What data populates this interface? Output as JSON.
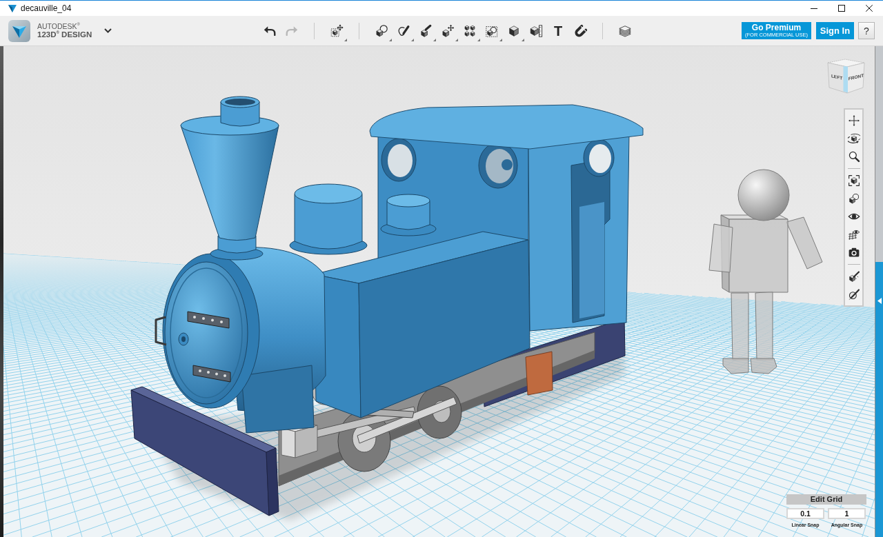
{
  "window": {
    "title": "decauville_04",
    "controls": [
      {
        "kind": "minimize"
      },
      {
        "kind": "maximize"
      },
      {
        "kind": "close"
      }
    ]
  },
  "app_menu": {
    "brand": "AUTODESK$^{®}$",
    "product": "123D$^{®}$ DESIGN"
  },
  "toolbar": {
    "groups": [
      {
        "tools": [
          {
            "kind": "undo",
            "disabled": false,
            "has_menu": false
          },
          {
            "kind": "redo",
            "disabled": true,
            "has_menu": false
          }
        ]
      },
      {
        "tools": [
          {
            "kind": "transform",
            "disabled": false,
            "has_menu": true
          }
        ]
      },
      {
        "tools": [
          {
            "kind": "primitives",
            "disabled": false,
            "has_menu": true
          },
          {
            "kind": "sketch",
            "disabled": false,
            "has_menu": true
          },
          {
            "kind": "construct",
            "disabled": false,
            "has_menu": true
          },
          {
            "kind": "modify",
            "disabled": false,
            "has_menu": true
          },
          {
            "kind": "pattern",
            "disabled": false,
            "has_menu": true
          },
          {
            "kind": "grouping",
            "disabled": false,
            "has_menu": true
          },
          {
            "kind": "combine",
            "disabled": false,
            "has_menu": true
          },
          {
            "kind": "measure",
            "disabled": false,
            "has_menu": false
          },
          {
            "kind": "text",
            "label": "T",
            "disabled": false,
            "has_menu": false
          },
          {
            "kind": "snap",
            "disabled": false,
            "has_menu": false
          }
        ]
      },
      {
        "tools": [
          {
            "kind": "material",
            "disabled": false,
            "has_menu": false
          }
        ]
      }
    ]
  },
  "account_buttons": [
    {
      "kind": "premium",
      "label": "Go Premium",
      "sublabel": "(FOR COMMERCIAL USE)"
    },
    {
      "kind": "sign_in",
      "label": "Sign In"
    },
    {
      "kind": "help",
      "label": "?"
    }
  ],
  "view_cube": {
    "faces": [
      {
        "label": "LEFT"
      },
      {
        "label": "FRONT"
      }
    ]
  },
  "navigation": {
    "groups": [
      {
        "tools": [
          {
            "kind": "pan"
          },
          {
            "kind": "orbit"
          },
          {
            "kind": "zoom"
          }
        ]
      },
      {
        "tools": [
          {
            "kind": "fit"
          },
          {
            "kind": "look_at"
          },
          {
            "kind": "visibility"
          },
          {
            "kind": "grid_visibility"
          },
          {
            "kind": "screenshot"
          }
        ]
      },
      {
        "tools": [
          {
            "kind": "material"
          },
          {
            "kind": "snap_material"
          }
        ]
      }
    ]
  },
  "edit_grid": {
    "title": "Edit Grid",
    "fields": [
      {
        "value": "0.1",
        "label": "Linear Snap"
      },
      {
        "value": "1",
        "label": "Angular Snap"
      }
    ]
  }
}
